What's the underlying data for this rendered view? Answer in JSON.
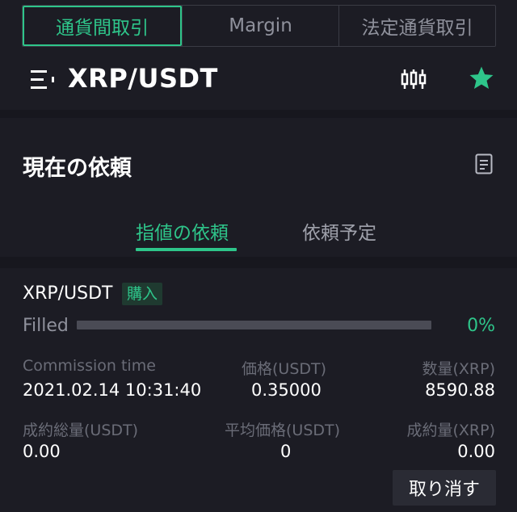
{
  "tabs": [
    {
      "label": "通貨間取引",
      "active": true
    },
    {
      "label": "Margin",
      "active": false
    },
    {
      "label": "法定通貨取引",
      "active": false
    }
  ],
  "pair": {
    "title": "XRP/USDT"
  },
  "icons": {
    "menu": "menu-lines-icon",
    "chart": "candlestick-icon",
    "favorite": "star-icon",
    "history": "document-icon"
  },
  "colors": {
    "accent": "#2ec58a",
    "background": "#1c1c24"
  },
  "section": {
    "title": "現在の依頼"
  },
  "subtabs": [
    {
      "label": "指値の依頼",
      "active": true
    },
    {
      "label": "依頼予定",
      "active": false
    }
  ],
  "order": {
    "pair": "XRP/USDT",
    "side": "購入",
    "filled_label": "Filled",
    "filled_fraction": 0.0,
    "filled_percent": "0%",
    "labels": {
      "time": "Commission time",
      "price": "価格(USDT)",
      "amount": "数量(XRP)",
      "total": "成約総量(USDT)",
      "avg_price": "平均価格(USDT)",
      "filled_amount": "成約量(XRP)"
    },
    "values": {
      "time": "2021.02.14 10:31:40",
      "price": "0.35000",
      "amount": "8590.88",
      "total": "0.00",
      "avg_price": "0",
      "filled_amount": "0.00"
    },
    "cancel_label": "取り消す"
  }
}
